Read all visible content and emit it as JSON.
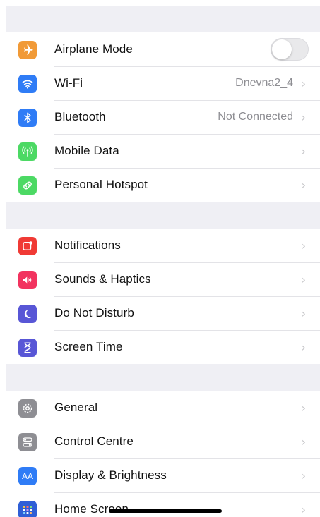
{
  "settings": {
    "groups": [
      {
        "items": [
          {
            "label": "Airplane Mode",
            "icon": "airplane-icon",
            "icon_color": "#f19a37",
            "control": "toggle",
            "toggle_on": false
          },
          {
            "label": "Wi-Fi",
            "icon": "wifi-icon",
            "icon_color": "#2f7cf6",
            "value": "Dnevna2_4",
            "chevron": "›"
          },
          {
            "label": "Bluetooth",
            "icon": "bluetooth-icon",
            "icon_color": "#2f7cf6",
            "value": "Not Connected",
            "chevron": "›"
          },
          {
            "label": "Mobile Data",
            "icon": "antenna-icon",
            "icon_color": "#4cd964",
            "chevron": "›"
          },
          {
            "label": "Personal Hotspot",
            "icon": "hotspot-icon",
            "icon_color": "#4cd964",
            "chevron": "›"
          }
        ]
      },
      {
        "items": [
          {
            "label": "Notifications",
            "icon": "notifications-icon",
            "icon_color": "#f03a35",
            "chevron": "›"
          },
          {
            "label": "Sounds & Haptics",
            "icon": "speaker-icon",
            "icon_color": "#f2335f",
            "chevron": "›"
          },
          {
            "label": "Do Not Disturb",
            "icon": "moon-icon",
            "icon_color": "#5856d6",
            "chevron": "›"
          },
          {
            "label": "Screen Time",
            "icon": "hourglass-icon",
            "icon_color": "#5856d6",
            "chevron": "›"
          }
        ]
      },
      {
        "items": [
          {
            "label": "General",
            "icon": "gear-icon",
            "icon_color": "#8e8e93",
            "chevron": "›"
          },
          {
            "label": "Control Centre",
            "icon": "switches-icon",
            "icon_color": "#8e8e93",
            "chevron": "›"
          },
          {
            "label": "Display & Brightness",
            "icon": "text-size-icon",
            "icon_color": "#2f7cf6",
            "icon_text": "AA",
            "chevron": "›"
          },
          {
            "label": "Home Screen",
            "icon": "app-grid-icon",
            "icon_color": "#2f5fd6",
            "chevron": "›"
          }
        ]
      }
    ]
  }
}
